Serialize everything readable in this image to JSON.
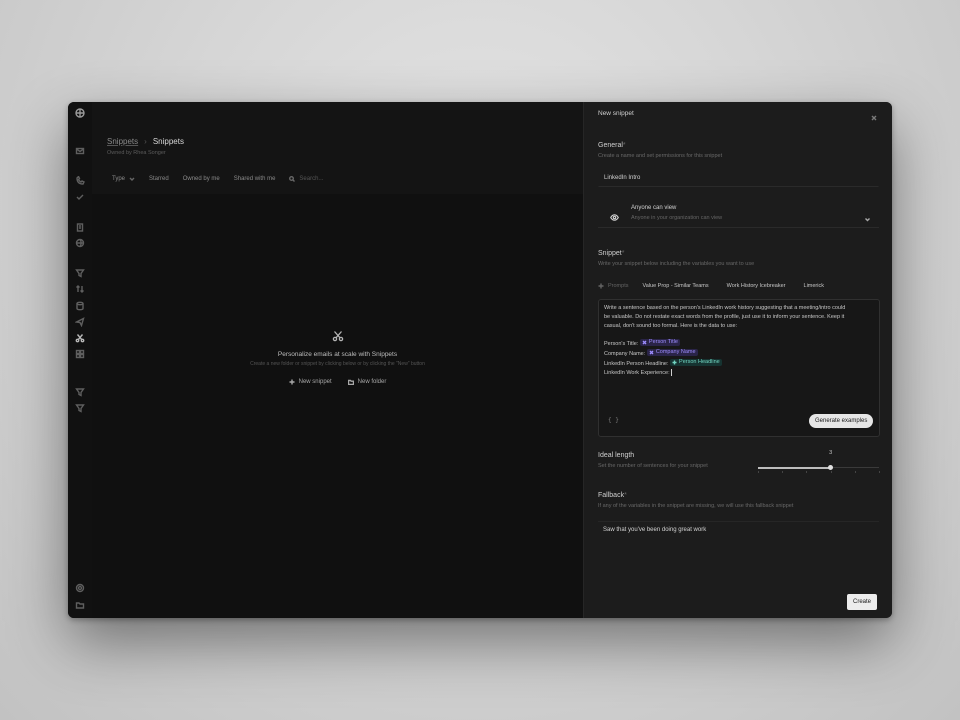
{
  "sidebar": {
    "icons": [
      "logo-icon",
      "inbox-icon",
      "phone-icon",
      "check-icon",
      "building-icon",
      "globe-icon",
      "filter-icon",
      "arrows-icon",
      "database-icon",
      "send-icon",
      "scissors-icon",
      "grid-icon",
      "funnel-icon",
      "funnel-alt-icon",
      "settings-icon",
      "folder-icon"
    ]
  },
  "main": {
    "breadcrumb_parent": "Snippets",
    "breadcrumb_sep": "›",
    "breadcrumb_current": "Snippets",
    "owner": "Owned by Rhea Songer",
    "filters": {
      "type": "Type",
      "starred": "Starred",
      "owned": "Owned by me",
      "shared": "Shared with me",
      "search_placeholder": "Search..."
    },
    "empty": {
      "title": "Personalize emails at scale with Snippets",
      "subtitle": "Create a new folder or snippet by clicking below or by clicking the \"New\" button",
      "new_snippet": "New snippet",
      "new_folder": "New folder"
    }
  },
  "panel": {
    "title": "New snippet",
    "general": {
      "title": "General",
      "required": "*",
      "subtitle": "Create a name and set permissions for this snippet",
      "name_value": "LinkedIn Intro",
      "permission_title": "Anyone can view",
      "permission_sub": "Anyone in your organization can view"
    },
    "snippet": {
      "title": "Snippet",
      "required": "*",
      "subtitle": "Write your snippet below including the variables you want to use",
      "prompts_label": "Prompts",
      "prompts": [
        "Value Prop - Similar Teams",
        "Work History Icebreaker",
        "Limerick"
      ],
      "body_lines": [
        "Write a sentence based on the person's LinkedIn work history suggesting that a meeting/intro could",
        "be valuable. Do not restate exact words from the profile, just use it to inform your sentence. Keep it",
        "casual, don't sound too formal. Here is the data to use:"
      ],
      "vars": [
        {
          "label": "Person's Title:",
          "value": "Person Title"
        },
        {
          "label": "Company Name:",
          "value": "Company Name"
        },
        {
          "label": "LinkedIn Person Headline:",
          "value": "Person Headline"
        }
      ],
      "last_line": "LinkedIn Work Experience:",
      "braces": "{ }",
      "generate": "Generate examples"
    },
    "length": {
      "title": "Ideal length",
      "subtitle": "Set the number of sentences for your snippet",
      "value": 3,
      "min": 0,
      "max": 5
    },
    "fallback": {
      "title": "Fallback",
      "required": "*",
      "subtitle": "If any of the variables in the snippet are missing, we will use this fallback snippet",
      "value": "Saw that you've been doing great work"
    },
    "create": "Create"
  }
}
